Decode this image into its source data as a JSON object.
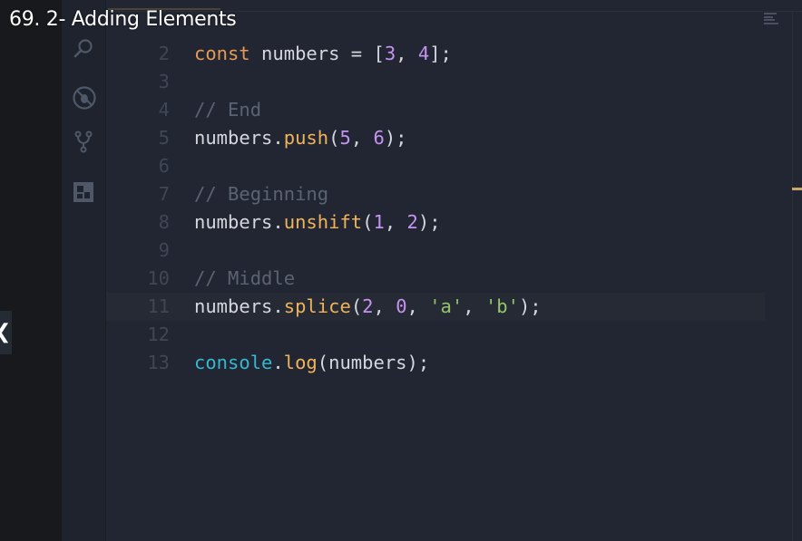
{
  "video": {
    "title": "69. 2- Adding Elements",
    "prev_icon": "chevron-left"
  },
  "activity_bar": {
    "icons": [
      "search-icon",
      "debug-icon",
      "source-control-icon",
      "extensions-icon"
    ]
  },
  "colors": {
    "keyword": "#e59a55",
    "function": "#f0b35a",
    "number": "#c594f0",
    "string": "#93c66b",
    "comment": "#5b6373",
    "object": "#35b8d0"
  },
  "editor": {
    "active_line": "11",
    "lines": [
      {
        "n": "2",
        "tokens": [
          {
            "t": "kw",
            "v": "const"
          },
          {
            "t": "txt",
            "v": " numbers = ["
          },
          {
            "t": "num",
            "v": "3"
          },
          {
            "t": "txt",
            "v": ", "
          },
          {
            "t": "num",
            "v": "4"
          },
          {
            "t": "txt",
            "v": "];"
          }
        ]
      },
      {
        "n": "3",
        "tokens": []
      },
      {
        "n": "4",
        "tokens": [
          {
            "t": "cm",
            "v": "// End"
          }
        ]
      },
      {
        "n": "5",
        "tokens": [
          {
            "t": "txt",
            "v": "numbers."
          },
          {
            "t": "fn",
            "v": "push"
          },
          {
            "t": "txt",
            "v": "("
          },
          {
            "t": "num",
            "v": "5"
          },
          {
            "t": "txt",
            "v": ", "
          },
          {
            "t": "num",
            "v": "6"
          },
          {
            "t": "txt",
            "v": ");"
          }
        ]
      },
      {
        "n": "6",
        "tokens": []
      },
      {
        "n": "7",
        "tokens": [
          {
            "t": "cm",
            "v": "// Beginning"
          }
        ]
      },
      {
        "n": "8",
        "tokens": [
          {
            "t": "txt",
            "v": "numbers."
          },
          {
            "t": "fn",
            "v": "unshift"
          },
          {
            "t": "txt",
            "v": "("
          },
          {
            "t": "num",
            "v": "1"
          },
          {
            "t": "txt",
            "v": ", "
          },
          {
            "t": "num",
            "v": "2"
          },
          {
            "t": "txt",
            "v": ");"
          }
        ]
      },
      {
        "n": "9",
        "tokens": []
      },
      {
        "n": "10",
        "tokens": [
          {
            "t": "cm",
            "v": "// Middle"
          }
        ]
      },
      {
        "n": "11",
        "tokens": [
          {
            "t": "txt",
            "v": "numbers."
          },
          {
            "t": "fn",
            "v": "splice"
          },
          {
            "t": "txt",
            "v": "("
          },
          {
            "t": "num",
            "v": "2"
          },
          {
            "t": "txt",
            "v": ", "
          },
          {
            "t": "num",
            "v": "0"
          },
          {
            "t": "txt",
            "v": ", "
          },
          {
            "t": "str",
            "v": "'a'"
          },
          {
            "t": "txt",
            "v": ", "
          },
          {
            "t": "str",
            "v": "'b'"
          },
          {
            "t": "txt",
            "v": ");"
          }
        ]
      },
      {
        "n": "12",
        "tokens": []
      },
      {
        "n": "13",
        "tokens": [
          {
            "t": "obj",
            "v": "console"
          },
          {
            "t": "txt",
            "v": "."
          },
          {
            "t": "fn",
            "v": "log"
          },
          {
            "t": "txt",
            "v": "(numbers);"
          }
        ]
      }
    ]
  }
}
